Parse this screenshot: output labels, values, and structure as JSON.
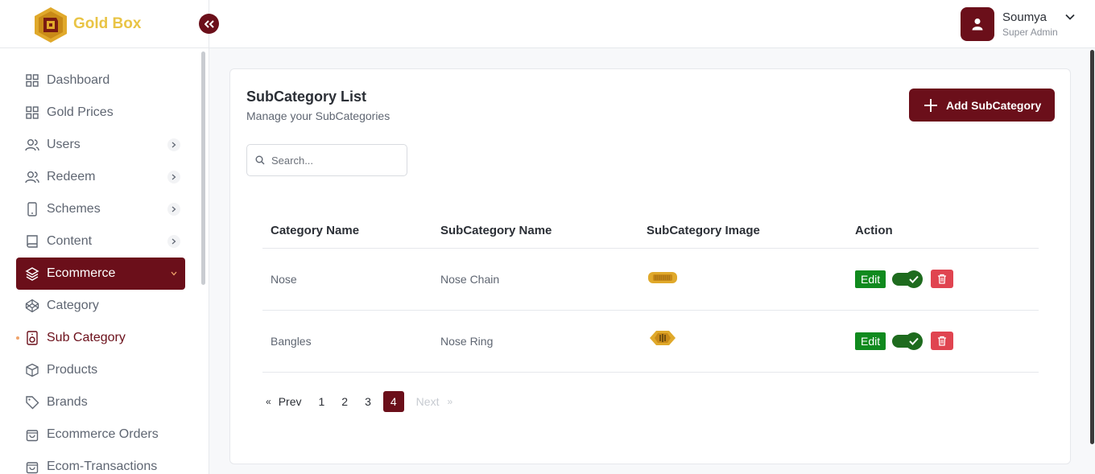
{
  "brand": {
    "name": "Gold Box"
  },
  "sidebar": {
    "items": [
      {
        "label": "Dashboard"
      },
      {
        "label": "Gold Prices"
      },
      {
        "label": "Users"
      },
      {
        "label": "Redeem"
      },
      {
        "label": "Schemes"
      },
      {
        "label": "Content"
      },
      {
        "label": "Ecommerce"
      },
      {
        "label": "Category"
      },
      {
        "label": "Sub Category"
      },
      {
        "label": "Products"
      },
      {
        "label": "Brands"
      },
      {
        "label": "Ecommerce Orders"
      },
      {
        "label": "Ecom-Transactions"
      }
    ]
  },
  "user": {
    "name": "Soumya",
    "role": "Super Admin"
  },
  "page": {
    "title": "SubCategory List",
    "subtitle": "Manage your SubCategories",
    "add_label": "Add SubCategory"
  },
  "search": {
    "placeholder": "Search..."
  },
  "table": {
    "headers": [
      "Category Name",
      "SubCategory Name",
      "SubCategory Image",
      "Action"
    ],
    "rows": [
      {
        "category": "Nose",
        "subcategory": "Nose Chain",
        "edit_label": "Edit"
      },
      {
        "category": "Bangles",
        "subcategory": "Nose Ring",
        "edit_label": "Edit"
      }
    ]
  },
  "pagination": {
    "prev": "Prev",
    "next": "Next",
    "pages": [
      "1",
      "2",
      "3",
      "4"
    ],
    "current": "4",
    "prev_glyph": "«",
    "next_glyph": "»"
  },
  "colors": {
    "primary": "#6b0f1a",
    "brand_gold": "#e9c445",
    "edit_green": "#108a1e",
    "delete_red": "#e04450"
  }
}
